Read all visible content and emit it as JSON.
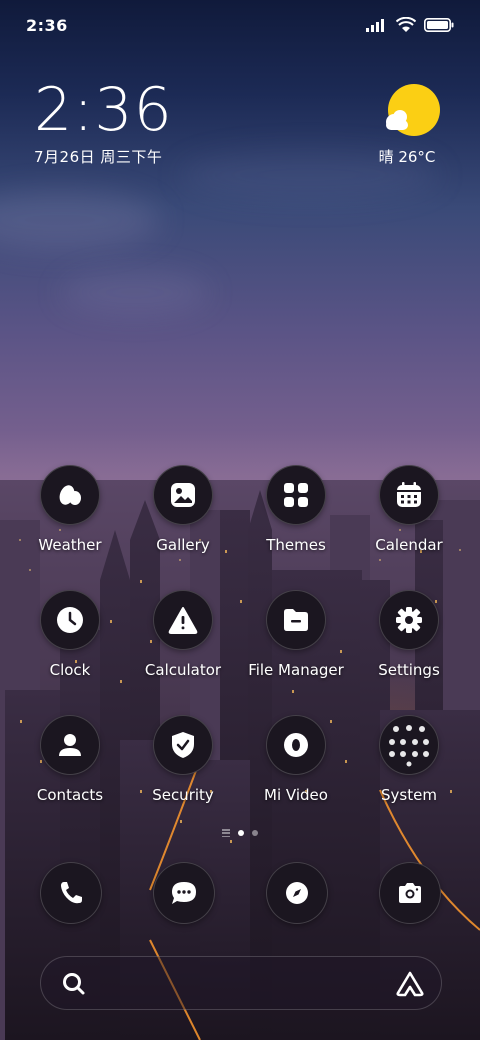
{
  "status_bar": {
    "time": "2:36"
  },
  "clock_widget": {
    "time": "2:36",
    "date": "7月26日 周三下午"
  },
  "weather_widget": {
    "text": "晴 26°C",
    "icon": "sunny-cloud-icon"
  },
  "apps": [
    {
      "label": "Weather",
      "icon": "weather-icon"
    },
    {
      "label": "Gallery",
      "icon": "gallery-icon"
    },
    {
      "label": "Themes",
      "icon": "themes-icon"
    },
    {
      "label": "Calendar",
      "icon": "calendar-icon"
    },
    {
      "label": "Clock",
      "icon": "clock-icon"
    },
    {
      "label": "Calculator",
      "icon": "calculator-icon"
    },
    {
      "label": "File Manager",
      "icon": "file-manager-icon"
    },
    {
      "label": "Settings",
      "icon": "settings-icon"
    },
    {
      "label": "Contacts",
      "icon": "contacts-icon"
    },
    {
      "label": "Security",
      "icon": "security-icon"
    },
    {
      "label": "Mi Video",
      "icon": "mi-video-icon"
    },
    {
      "label": "System",
      "icon": "folder-icon"
    }
  ],
  "dock": [
    {
      "icon": "phone-icon"
    },
    {
      "icon": "messages-icon"
    },
    {
      "icon": "browser-icon"
    },
    {
      "icon": "camera-icon"
    }
  ],
  "search_bar": {
    "icon": "search-icon",
    "assistant_icon": "assistant-icon"
  },
  "colors": {
    "sun": "#fbcf14",
    "icon_bg": "#1b1620"
  }
}
